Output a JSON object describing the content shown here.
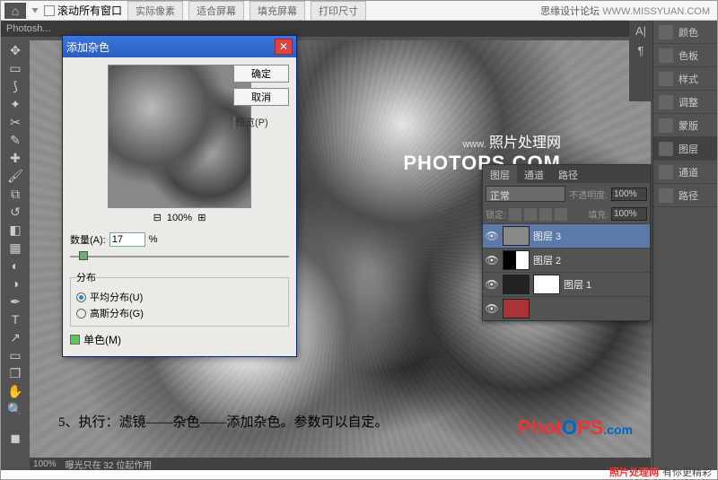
{
  "credit": {
    "site": "思缘设计论坛",
    "url": "WWW.MISSYUAN.COM"
  },
  "options": {
    "scroll_all": "滚动所有窗口",
    "btns": [
      "实际像素",
      "适合屏幕",
      "填充屏幕",
      "打印尺寸"
    ]
  },
  "tab": {
    "label": "Photosh..."
  },
  "dialog": {
    "title": "添加杂色",
    "ok": "确定",
    "cancel": "取消",
    "preview": "预览(P)",
    "zoom": "100%",
    "amount_label": "数量(A):",
    "amount_value": "17",
    "amount_unit": "%",
    "dist_legend": "分布",
    "dist_uniform": "平均分布(U)",
    "dist_gaussian": "高斯分布(G)",
    "mono": "单色(M)"
  },
  "layers": {
    "tabs": [
      "图层",
      "通道",
      "路径"
    ],
    "blend": "正常",
    "opacity_label": "不透明度:",
    "opacity": "100%",
    "lock_label": "锁定:",
    "fill_label": "填充:",
    "fill": "100%",
    "items": [
      {
        "name": "图层 3"
      },
      {
        "name": "图层 2"
      },
      {
        "name": "图层 1"
      }
    ]
  },
  "rpanels": [
    "颜色",
    "色板",
    "样式",
    "调整",
    "蒙版",
    "图层",
    "通道",
    "路径"
  ],
  "watermark": {
    "line1": "www.",
    "line2": "照片处理网",
    "big": "PHOTOPS.COM"
  },
  "caption": "5、执行：滤镜——杂色——添加杂色。参数可以自定。",
  "logo": {
    "t": "PhotOPS.com"
  },
  "status": {
    "zoom": "100%",
    "info": "曝光只在 32 位起作用"
  },
  "footer": {
    "a": "照片处理网",
    "b": "有你更精彩"
  }
}
